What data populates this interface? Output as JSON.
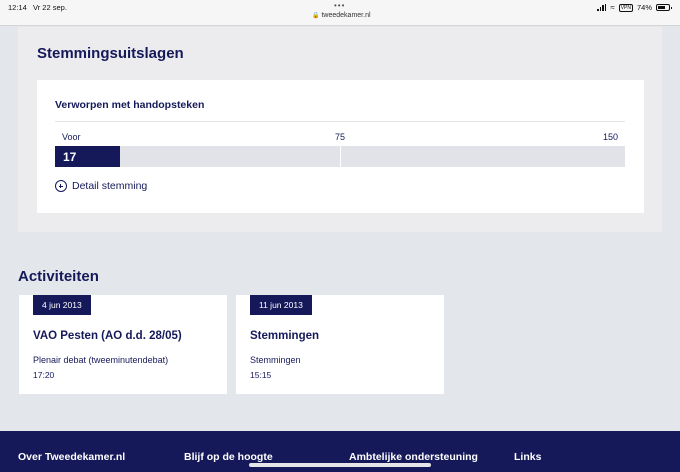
{
  "status_bar": {
    "time": "12:14",
    "date": "Vr 22 sep.",
    "url": "tweedekamer.nl",
    "vpn": "VPN",
    "battery": "74%",
    "battery_level": 0.74
  },
  "results": {
    "title": "Stemmingsuitslagen",
    "card_title": "Verworpen met handopsteken",
    "axis": {
      "start_label": "Voor",
      "mid_label": "75",
      "end_label": "150"
    },
    "scale_max": 150,
    "votes_for": 17,
    "votes_for_label": "17",
    "detail_link": "Detail stemming"
  },
  "activities": {
    "title": "Activiteiten",
    "items": [
      {
        "date": "4 jun 2013",
        "name": "VAO Pesten (AO d.d. 28/05)",
        "type": "Plenair debat (tweeminutendebat)",
        "time": "17:20"
      },
      {
        "date": "11 jun 2013",
        "name": "Stemmingen",
        "type": "Stemmingen",
        "time": "15:15"
      }
    ]
  },
  "footer": {
    "links": [
      "Over Tweedekamer.nl",
      "Blijf op de hoogte",
      "Ambtelijke ondersteuning",
      "Links"
    ]
  },
  "colors": {
    "brand_navy": "#15195a",
    "page_bg": "#e3e6ea",
    "bar_track": "#e1e3e8"
  }
}
